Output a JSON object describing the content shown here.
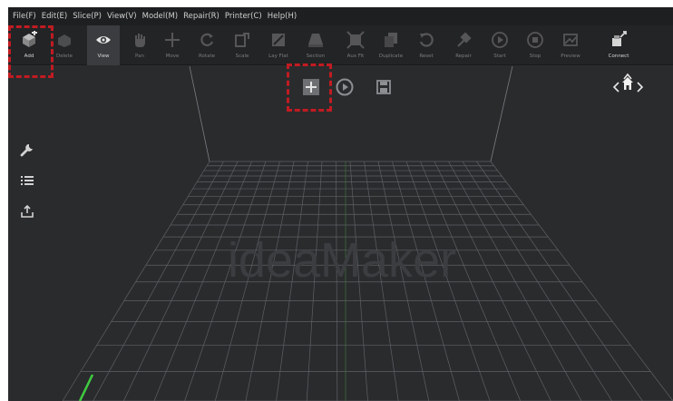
{
  "menu": [
    {
      "label": "File(F)"
    },
    {
      "label": "Edit(E)"
    },
    {
      "label": "Slice(P)"
    },
    {
      "label": "View(V)"
    },
    {
      "label": "Model(M)"
    },
    {
      "label": "Repair(R)"
    },
    {
      "label": "Printer(C)"
    },
    {
      "label": "Help(H)"
    }
  ],
  "toolbar": {
    "add": "Add",
    "delete": "Delete",
    "view": "View",
    "pan": "Pan",
    "move": "Move",
    "rotate": "Rotate",
    "scale": "Scale",
    "layflat": "Lay Flat",
    "section": "Section",
    "autofit": "Aux Fit",
    "duplicate": "Duplicate",
    "reset": "Reset",
    "repair": "Repair",
    "start": "Start",
    "stop": "Stop",
    "preview": "Preview",
    "connect": "Connect"
  },
  "watermark": "ideaMaker",
  "colors": {
    "background": "#2a2b2d",
    "highlight": "#c21b22",
    "grid": "#5e6064",
    "axis_y": "#3fcc3f"
  },
  "icons": {
    "side": [
      "wrench-icon",
      "list-icon",
      "upload-icon"
    ],
    "controls": [
      "plus-icon",
      "play-icon",
      "save-icon"
    ],
    "nav": [
      "chevron-up-icon",
      "chevron-left-icon",
      "home-icon",
      "chevron-right-icon"
    ]
  }
}
